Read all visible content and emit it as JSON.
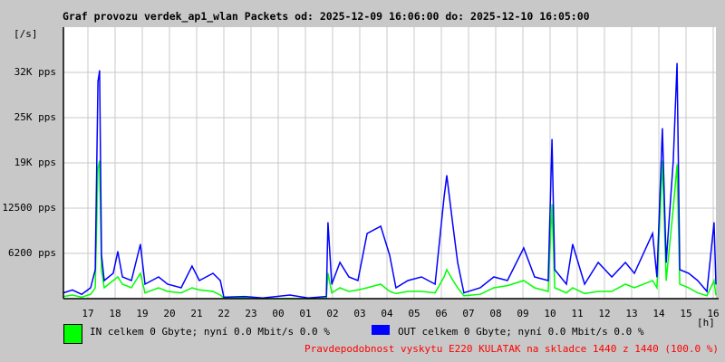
{
  "chart_data": {
    "type": "line",
    "title": "Graf provozu verdek_ap1_wlan Packets od: 2025-12-09 16:06:00 do: 2025-12-10 16:05:00",
    "ylabel": "[/s]",
    "xlabel": "[h]",
    "ylim": [
      0,
      37500
    ],
    "xlim_hours_since_start": [
      0,
      24
    ],
    "y_ticks": [
      {
        "value": 6250,
        "label": "6200 pps"
      },
      {
        "value": 12500,
        "label": "12500 pps"
      },
      {
        "value": 18750,
        "label": "19K pps"
      },
      {
        "value": 25000,
        "label": "25K pps"
      },
      {
        "value": 31250,
        "label": "32K pps"
      }
    ],
    "x_ticks": [
      {
        "value": 0.9,
        "label": "17"
      },
      {
        "value": 1.9,
        "label": "18"
      },
      {
        "value": 2.9,
        "label": "19"
      },
      {
        "value": 3.9,
        "label": "20"
      },
      {
        "value": 4.9,
        "label": "21"
      },
      {
        "value": 5.9,
        "label": "22"
      },
      {
        "value": 6.9,
        "label": "23"
      },
      {
        "value": 7.9,
        "label": "00"
      },
      {
        "value": 8.9,
        "label": "01"
      },
      {
        "value": 9.9,
        "label": "02"
      },
      {
        "value": 10.9,
        "label": "03"
      },
      {
        "value": 11.9,
        "label": "04"
      },
      {
        "value": 12.9,
        "label": "05"
      },
      {
        "value": 13.9,
        "label": "06"
      },
      {
        "value": 14.9,
        "label": "07"
      },
      {
        "value": 15.9,
        "label": "08"
      },
      {
        "value": 16.9,
        "label": "09"
      },
      {
        "value": 17.9,
        "label": "10"
      },
      {
        "value": 18.9,
        "label": "11"
      },
      {
        "value": 19.9,
        "label": "12"
      },
      {
        "value": 20.9,
        "label": "13"
      },
      {
        "value": 21.9,
        "label": "14"
      },
      {
        "value": 22.9,
        "label": "15"
      },
      {
        "value": 23.9,
        "label": "16"
      }
    ],
    "grid": true,
    "series": [
      {
        "name": "IN",
        "color": "#00ff00",
        "points": [
          [
            0,
            300
          ],
          [
            0.33,
            500
          ],
          [
            0.67,
            200
          ],
          [
            1.0,
            600
          ],
          [
            1.17,
            1500
          ],
          [
            1.27,
            18000
          ],
          [
            1.33,
            19000
          ],
          [
            1.4,
            4000
          ],
          [
            1.5,
            1500
          ],
          [
            1.83,
            2500
          ],
          [
            2.0,
            3000
          ],
          [
            2.17,
            2000
          ],
          [
            2.5,
            1500
          ],
          [
            2.83,
            3500
          ],
          [
            3.0,
            800
          ],
          [
            3.5,
            1500
          ],
          [
            3.83,
            1000
          ],
          [
            4.33,
            800
          ],
          [
            4.73,
            1500
          ],
          [
            5.0,
            1200
          ],
          [
            5.5,
            1000
          ],
          [
            5.77,
            500
          ],
          [
            5.9,
            100
          ],
          [
            6.67,
            100
          ],
          [
            7.33,
            0
          ],
          [
            8.33,
            0
          ],
          [
            9.0,
            0
          ],
          [
            9.67,
            100
          ],
          [
            9.73,
            3500
          ],
          [
            9.87,
            800
          ],
          [
            10.17,
            1500
          ],
          [
            10.5,
            1000
          ],
          [
            10.83,
            1200
          ],
          [
            11.17,
            1500
          ],
          [
            11.67,
            2000
          ],
          [
            12.0,
            1000
          ],
          [
            12.23,
            700
          ],
          [
            12.67,
            1000
          ],
          [
            13.17,
            1000
          ],
          [
            13.67,
            800
          ],
          [
            14.0,
            3000
          ],
          [
            14.1,
            4000
          ],
          [
            14.33,
            2500
          ],
          [
            14.5,
            1500
          ],
          [
            14.73,
            400
          ],
          [
            15.33,
            600
          ],
          [
            15.83,
            1500
          ],
          [
            16.33,
            1800
          ],
          [
            16.93,
            2500
          ],
          [
            17.33,
            1500
          ],
          [
            17.83,
            1000
          ],
          [
            17.97,
            13000
          ],
          [
            18.07,
            1500
          ],
          [
            18.5,
            800
          ],
          [
            18.73,
            1500
          ],
          [
            19.17,
            700
          ],
          [
            19.67,
            1000
          ],
          [
            20.17,
            1000
          ],
          [
            20.67,
            2000
          ],
          [
            21.0,
            1500
          ],
          [
            21.67,
            2500
          ],
          [
            21.83,
            1500
          ],
          [
            22.03,
            19000
          ],
          [
            22.17,
            2500
          ],
          [
            22.43,
            12500
          ],
          [
            22.57,
            18500
          ],
          [
            22.67,
            2000
          ],
          [
            23.0,
            1500
          ],
          [
            23.33,
            800
          ],
          [
            23.67,
            400
          ],
          [
            23.93,
            2500
          ],
          [
            24,
            500
          ]
        ]
      },
      {
        "name": "OUT",
        "color": "#0000ff",
        "points": [
          [
            0,
            800
          ],
          [
            0.33,
            1200
          ],
          [
            0.67,
            600
          ],
          [
            1.0,
            1500
          ],
          [
            1.17,
            4000
          ],
          [
            1.27,
            30000
          ],
          [
            1.33,
            31500
          ],
          [
            1.4,
            6000
          ],
          [
            1.5,
            2500
          ],
          [
            1.83,
            3500
          ],
          [
            2.0,
            6500
          ],
          [
            2.17,
            3000
          ],
          [
            2.5,
            2500
          ],
          [
            2.83,
            7500
          ],
          [
            3.0,
            2000
          ],
          [
            3.5,
            3000
          ],
          [
            3.83,
            2000
          ],
          [
            4.33,
            1500
          ],
          [
            4.73,
            4500
          ],
          [
            5.0,
            2500
          ],
          [
            5.5,
            3500
          ],
          [
            5.77,
            2500
          ],
          [
            5.9,
            200
          ],
          [
            6.67,
            300
          ],
          [
            7.33,
            100
          ],
          [
            8.33,
            500
          ],
          [
            9.0,
            100
          ],
          [
            9.67,
            300
          ],
          [
            9.73,
            10500
          ],
          [
            9.87,
            2000
          ],
          [
            10.17,
            5000
          ],
          [
            10.5,
            3000
          ],
          [
            10.83,
            2500
          ],
          [
            11.17,
            9000
          ],
          [
            11.67,
            10000
          ],
          [
            12.0,
            6000
          ],
          [
            12.23,
            1500
          ],
          [
            12.67,
            2500
          ],
          [
            13.17,
            3000
          ],
          [
            13.67,
            2000
          ],
          [
            14.0,
            14000
          ],
          [
            14.1,
            17000
          ],
          [
            14.33,
            10000
          ],
          [
            14.5,
            5000
          ],
          [
            14.73,
            800
          ],
          [
            15.33,
            1500
          ],
          [
            15.83,
            3000
          ],
          [
            16.33,
            2500
          ],
          [
            16.93,
            7000
          ],
          [
            17.33,
            3000
          ],
          [
            17.83,
            2500
          ],
          [
            17.97,
            22000
          ],
          [
            18.07,
            4000
          ],
          [
            18.5,
            2000
          ],
          [
            18.73,
            7500
          ],
          [
            19.17,
            2000
          ],
          [
            19.67,
            5000
          ],
          [
            20.17,
            3000
          ],
          [
            20.67,
            5000
          ],
          [
            21.0,
            3500
          ],
          [
            21.67,
            9000
          ],
          [
            21.83,
            3000
          ],
          [
            22.03,
            23500
          ],
          [
            22.17,
            5000
          ],
          [
            22.43,
            19000
          ],
          [
            22.57,
            32500
          ],
          [
            22.67,
            4000
          ],
          [
            23.0,
            3500
          ],
          [
            23.33,
            2500
          ],
          [
            23.67,
            1000
          ],
          [
            23.93,
            10500
          ],
          [
            24,
            2000
          ]
        ]
      }
    ]
  },
  "legend": {
    "in_text": "IN celkem 0 Gbyte; nyní    0.0 Mbit/s 0.0 %",
    "out_text": "OUT celkem 0 Gbyte; nyní    0.0 Mbit/s 0.0 %"
  },
  "footer": "Pravdepodobnost vyskytu E220 KULATAK na skladce 1440 z 1440 (100.0 %)"
}
